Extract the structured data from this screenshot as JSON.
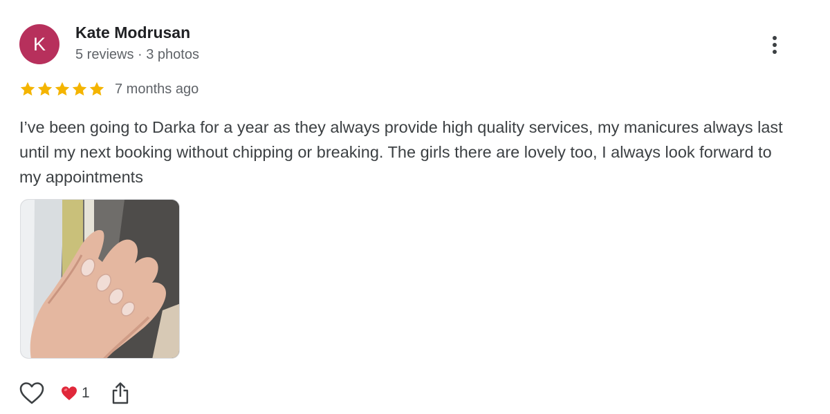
{
  "review": {
    "author": {
      "initial": "K",
      "name": "Kate Modrusan",
      "meta": "5 reviews · 3 photos",
      "avatar_color": "#b7305c"
    },
    "rating": 5,
    "rating_max": 5,
    "time": "7 months ago",
    "text": "I’ve been going to Darka for a year as they always provide high quality services, my manicures always last until my next booking without chipping or breaking. The girls there are lovely too, I always look forward to my appointments",
    "photo_count_shown": 1,
    "reactions": {
      "heart_count": "1"
    }
  },
  "icons": {
    "more": "more-vert-icon",
    "star": "star-icon",
    "like": "heart-outline-icon",
    "reaction": "red-heart-emoji-icon",
    "share": "share-icon"
  },
  "colors": {
    "star": "#f4b400",
    "heart_reaction": "#e0283a",
    "meta_text": "#5f6368"
  }
}
